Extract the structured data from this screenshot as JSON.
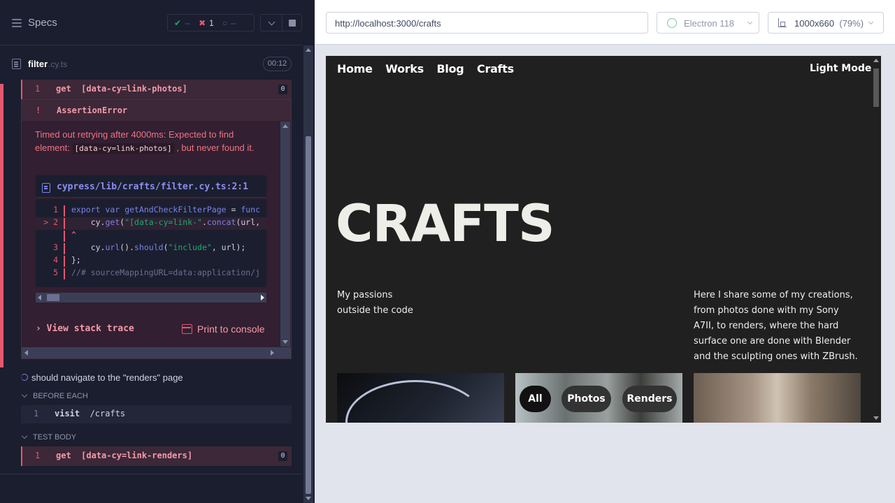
{
  "reporter": {
    "specs_label": "Specs",
    "stats": {
      "pass_icon": "✔",
      "pass_count": "--",
      "fail_icon": "✖",
      "fail_count": "1",
      "pending_icon": "○",
      "pending_count": "--"
    },
    "spec_file": {
      "name": "filter",
      "ext": ".cy.ts",
      "duration": "00:12"
    },
    "failed_command": {
      "number": "1",
      "name": "get",
      "selector": "[data-cy=link-photos]",
      "count": "0"
    },
    "error": {
      "bang": "!",
      "title": "AssertionError",
      "message_pre": "Timed out retrying after 4000ms: Expected to find element:",
      "message_code": "[data-cy=link-photos]",
      "message_post": ", but never found it.",
      "file_link": "cypress/lib/crafts/filter.cy.ts:2:1",
      "code_lines": [
        {
          "ln": "1",
          "marker": "",
          "html": "<span class=\"kw\">export var</span> <span class=\"fn\">getAndCheckFilterPage</span> = <span class=\"kw\">func</span>"
        },
        {
          "ln": "2",
          "marker": "> ",
          "html": "    cy.<span class=\"fn\">get</span>(<span class=\"str\">\"[data-cy=link-\"</span>.<span class=\"fn\">concat</span>(url,"
        },
        {
          "ln": "",
          "marker": "",
          "html": "<span class=\"fail-ic\">^</span>"
        },
        {
          "ln": "3",
          "marker": "",
          "html": "    cy.<span class=\"fn\">url</span>().<span class=\"fn\">should</span>(<span class=\"str\">\"include\"</span>, url);"
        },
        {
          "ln": "4",
          "marker": "",
          "html": "};"
        },
        {
          "ln": "5",
          "marker": "",
          "html": "<span class=\"cm\">//# sourceMappingURL=data:application/j</span>"
        }
      ],
      "stack_label": "View stack trace",
      "print_label": "Print to console"
    },
    "next_test": {
      "title": "should navigate to the \"renders\" page"
    },
    "before_each": {
      "label": "BEFORE EACH",
      "cmd_number": "1",
      "cmd_name": "visit",
      "cmd_arg": "/crafts"
    },
    "test_body": {
      "label": "TEST BODY",
      "cmd_number": "1",
      "cmd_name": "get",
      "cmd_arg": "[data-cy=link-renders]",
      "count": "0"
    }
  },
  "runner": {
    "url": "http://localhost:3000/crafts",
    "browser": "Electron 118",
    "viewport": "1000x660",
    "viewport_scale": "(79%)"
  },
  "app": {
    "nav": [
      "Home",
      "Works",
      "Blog",
      "Crafts"
    ],
    "mode_toggle": "Light Mode",
    "title": "CRAFTS",
    "tagline_1": "My passions",
    "tagline_2": "outside the code",
    "description": "Here I share some of my creations, from photos done with my Sony A7II, to renders, where the hard surface one are done with Blender and the sculpting ones with ZBrush.",
    "filters": [
      "All",
      "Photos",
      "Renders"
    ],
    "active_filter": "All"
  },
  "colors": {
    "fail": "#e45770",
    "pass": "#1fa971",
    "accent": "#7c82e8",
    "reporter_bg": "#1b1e2e",
    "app_bg": "#202020"
  }
}
